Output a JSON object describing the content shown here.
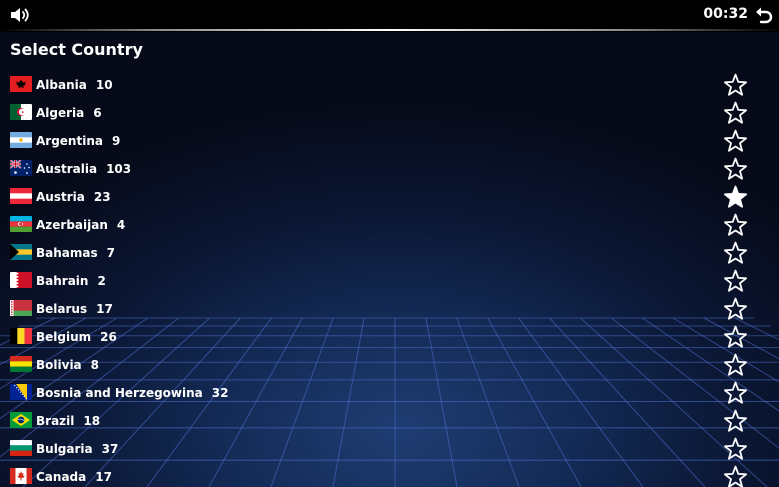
{
  "topbar": {
    "timer": "00:32",
    "sound_icon": "speaker-icon",
    "back_icon": "undo-arrow-icon"
  },
  "title": "Select Country",
  "countries": [
    {
      "name": "Albania",
      "count": "10",
      "favorite": false,
      "flag": "albania-flag-icon"
    },
    {
      "name": "Algeria",
      "count": "6",
      "favorite": false,
      "flag": "algeria-flag-icon"
    },
    {
      "name": "Argentina",
      "count": "9",
      "favorite": false,
      "flag": "argentina-flag-icon"
    },
    {
      "name": "Australia",
      "count": "103",
      "favorite": false,
      "flag": "australia-flag-icon"
    },
    {
      "name": "Austria",
      "count": "23",
      "favorite": true,
      "flag": "austria-flag-icon"
    },
    {
      "name": "Azerbaijan",
      "count": "4",
      "favorite": false,
      "flag": "azerbaijan-flag-icon"
    },
    {
      "name": "Bahamas",
      "count": "7",
      "favorite": false,
      "flag": "bahamas-flag-icon"
    },
    {
      "name": "Bahrain",
      "count": "2",
      "favorite": false,
      "flag": "bahrain-flag-icon"
    },
    {
      "name": "Belarus",
      "count": "17",
      "favorite": false,
      "flag": "belarus-flag-icon"
    },
    {
      "name": "Belgium",
      "count": "26",
      "favorite": false,
      "flag": "belgium-flag-icon"
    },
    {
      "name": "Bolivia",
      "count": "8",
      "favorite": false,
      "flag": "bolivia-flag-icon"
    },
    {
      "name": "Bosnia and Herzegowina",
      "count": "32",
      "favorite": false,
      "flag": "bosnia-flag-icon"
    },
    {
      "name": "Brazil",
      "count": "18",
      "favorite": false,
      "flag": "brazil-flag-icon"
    },
    {
      "name": "Bulgaria",
      "count": "37",
      "favorite": false,
      "flag": "bulgaria-flag-icon"
    },
    {
      "name": "Canada",
      "count": "17",
      "favorite": false,
      "flag": "canada-flag-icon"
    }
  ],
  "colors": {
    "background": "#060a18",
    "glow": "#1f3d73",
    "grid_line": "#4f6fd0",
    "text": "#ffffff"
  }
}
